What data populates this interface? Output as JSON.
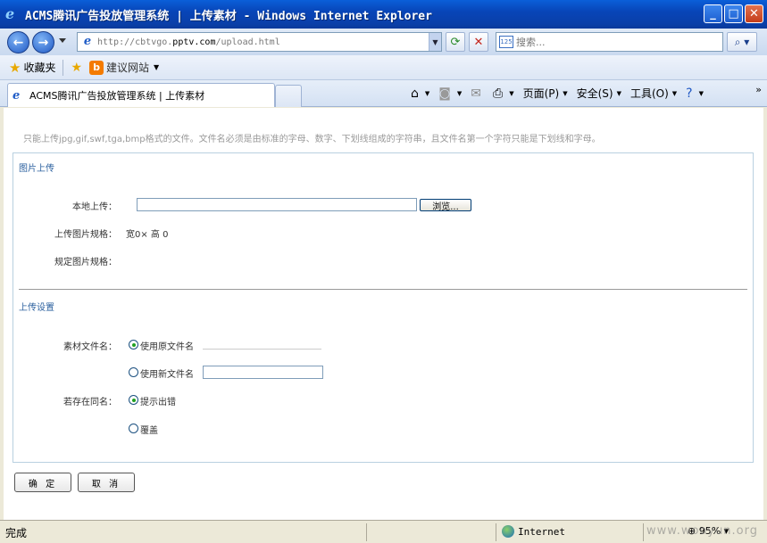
{
  "window": {
    "title": "ACMS腾讯广告投放管理系统 | 上传素材 - Windows Internet Explorer"
  },
  "address_bar": {
    "url_prefix": "http://cbtvgo.",
    "url_domain": "pptv.com",
    "url_suffix": "/upload.html"
  },
  "search": {
    "placeholder": "搜索..."
  },
  "favorites_bar": {
    "favorites_label": "收藏夹",
    "suggested_sites_label": "建议网站"
  },
  "tab": {
    "title": "ACMS腾讯广告投放管理系统 | 上传素材"
  },
  "command_bar": {
    "page_label": "页面(P)",
    "safety_label": "安全(S)",
    "tools_label": "工具(O)"
  },
  "page": {
    "notice": "只能上传jpg,gif,swf,tga,bmp格式的文件。文件名必须是由标准的字母、数字、下划线组成的字符串，且文件名第一个字符只能是下划线和字母。",
    "image_upload": {
      "section_title": "图片上传",
      "local_upload_label": "本地上传：",
      "browse_button": "浏览...",
      "image_spec_label": "上传图片规格：",
      "image_spec_value": "宽0× 高 0",
      "required_spec_label": "规定图片规格：",
      "required_spec_value": ""
    },
    "upload_settings": {
      "section_title": "上传设置",
      "filename_label": "素材文件名：",
      "use_original_name": "使用原文件名",
      "use_new_name": "使用新文件名",
      "new_name_value": "",
      "duplicate_label": "若存在同名：",
      "show_error": "提示出错",
      "overwrite": "覆盖",
      "filename_choice": "original",
      "duplicate_choice": "error"
    },
    "ok_button": "确 定",
    "cancel_button": "取 消"
  },
  "status_bar": {
    "status_text": "完成",
    "zone": "Internet",
    "zoom": "95%"
  },
  "watermark": "www.wooyun.org",
  "colors": {
    "titlebar_blue": "#0845b8",
    "section_title": "#2a5f9e",
    "panel_border": "#b9d0e0",
    "notice_text": "#999999"
  }
}
